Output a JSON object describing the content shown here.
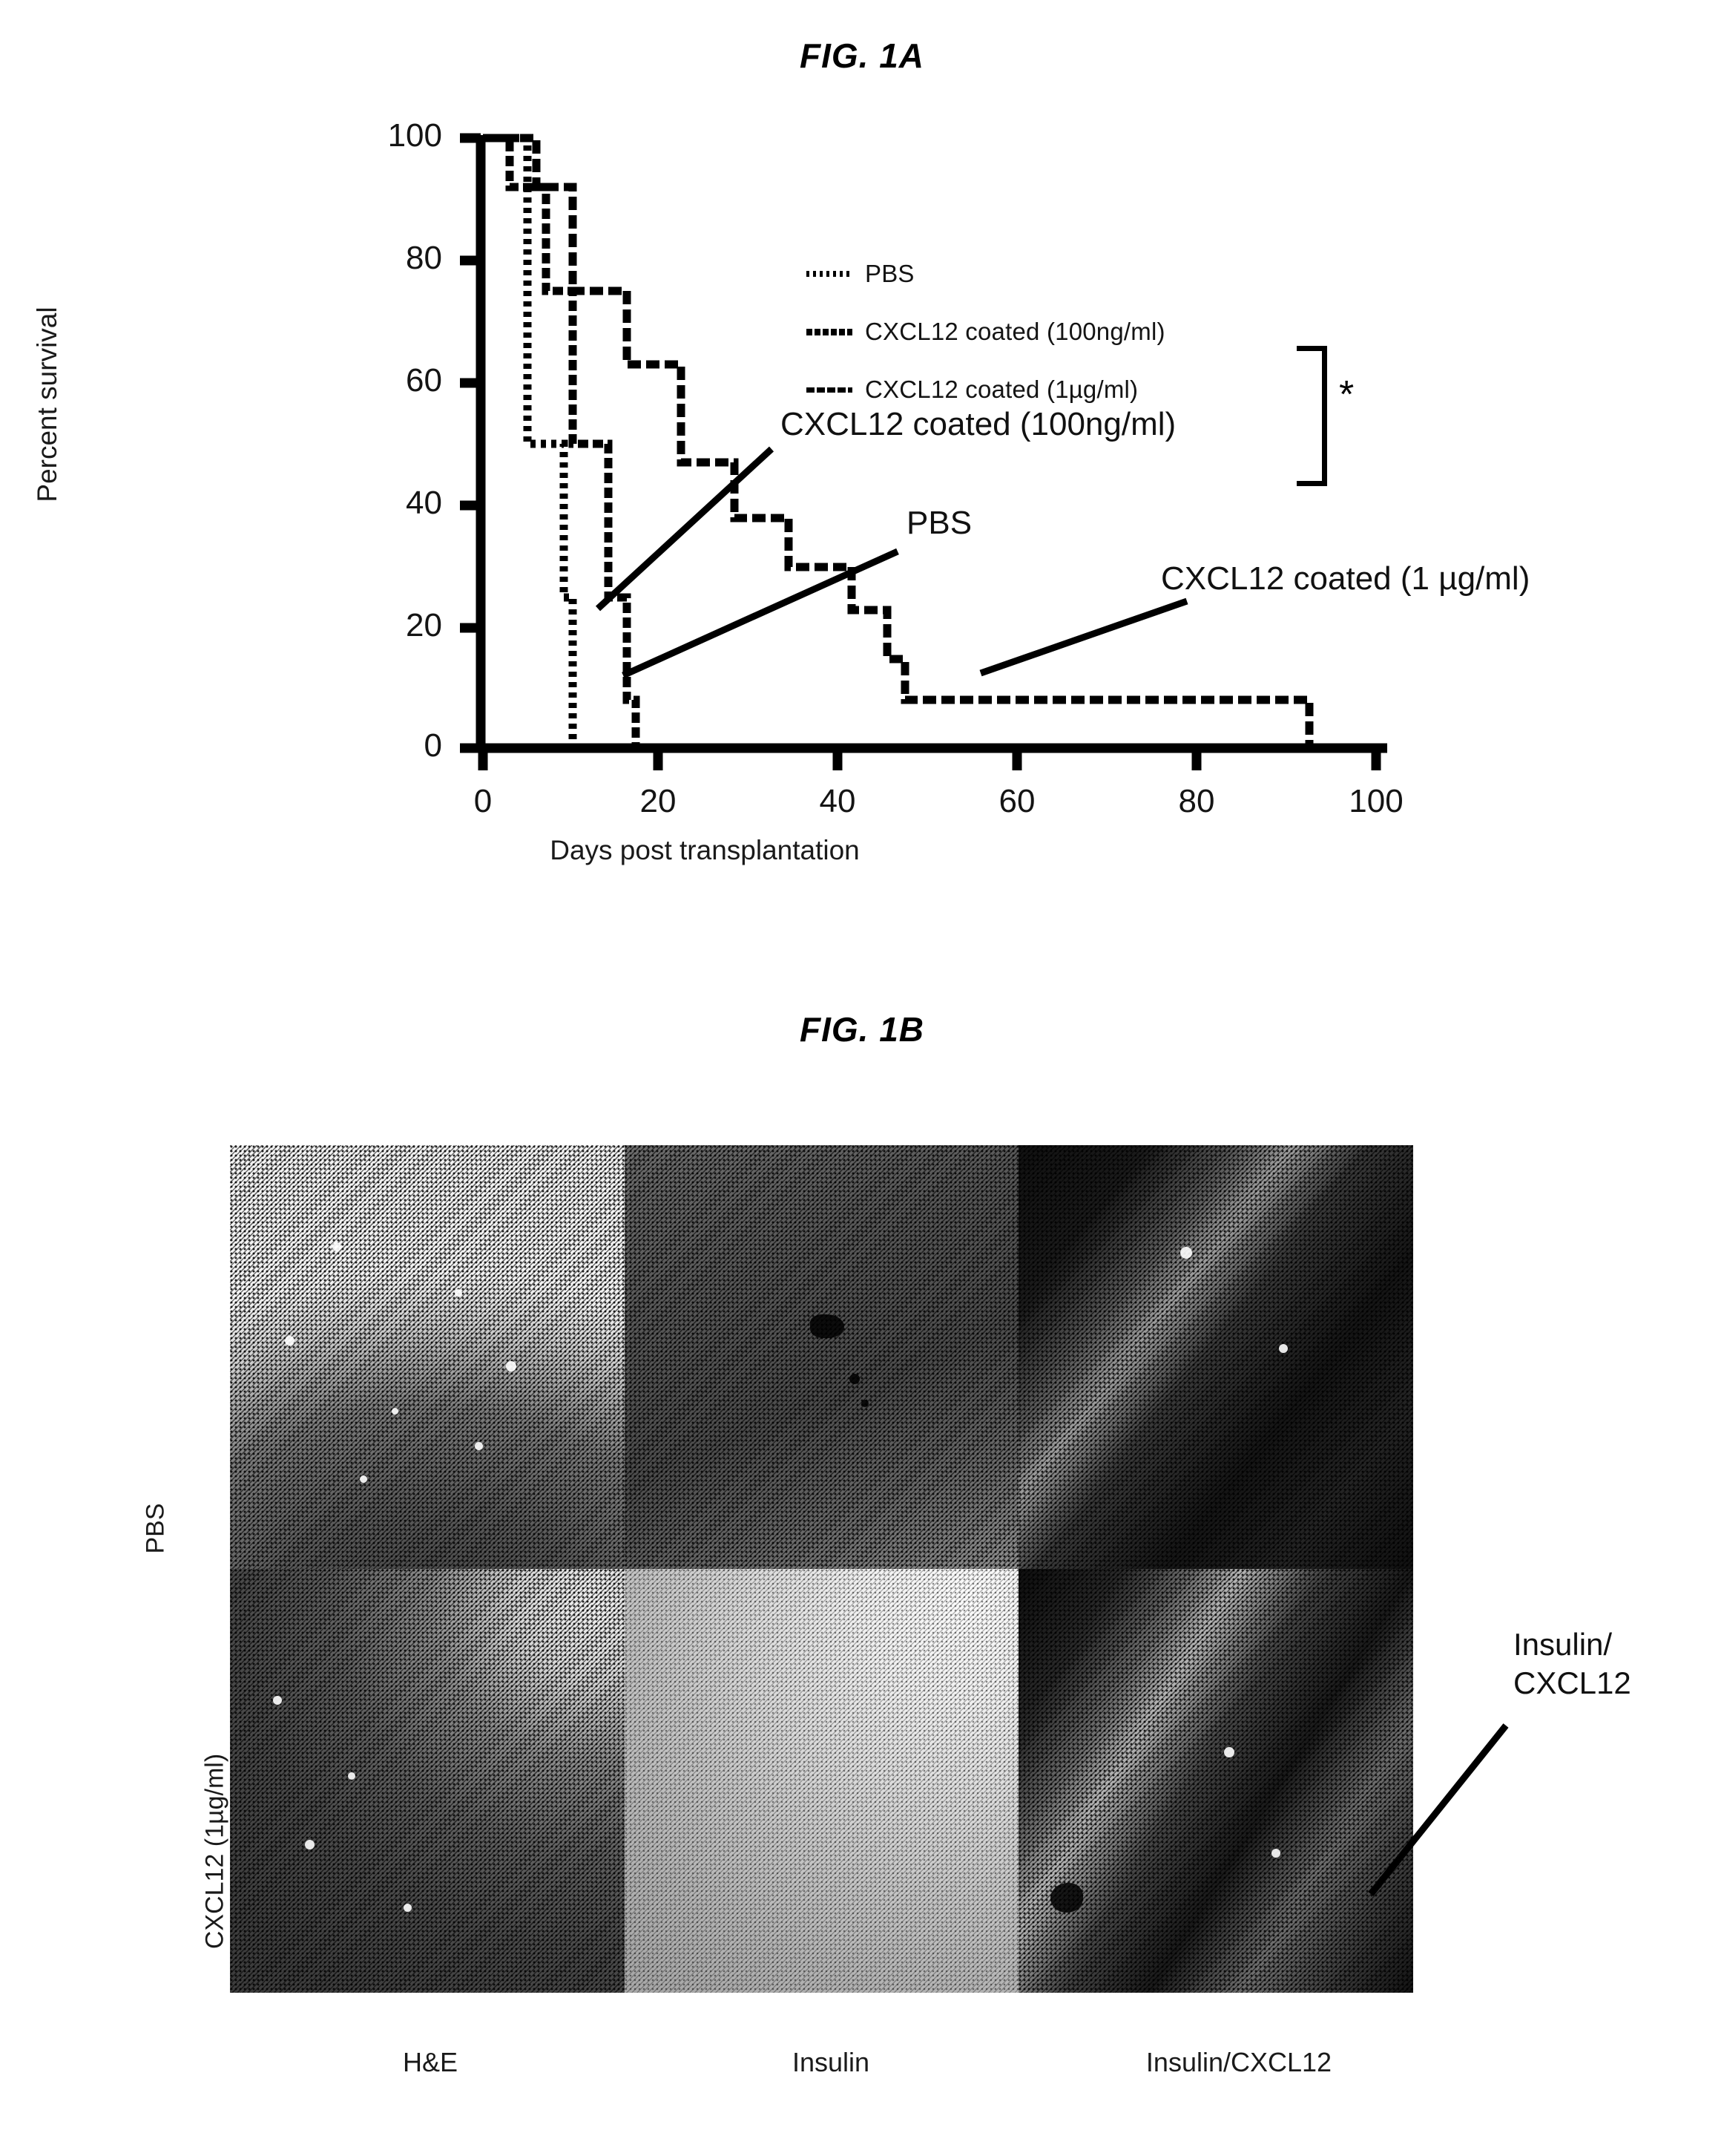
{
  "figures": {
    "fig1a_title": "FIG. 1A",
    "fig1b_title": "FIG. 1B"
  },
  "chart_data": {
    "type": "line",
    "subtype": "kaplan-meier-step",
    "title": "FIG. 1A",
    "xlabel": "Days post transplantation",
    "ylabel": "Percent survival",
    "xlim": [
      0,
      103
    ],
    "ylim": [
      0,
      103
    ],
    "xticks": [
      0,
      20,
      40,
      60,
      80,
      100
    ],
    "yticks": [
      0,
      20,
      40,
      60,
      80,
      100
    ],
    "xtick_labels": [
      "0",
      "20",
      "40",
      "60",
      "80",
      "100"
    ],
    "ytick_labels": [
      "0",
      "20",
      "40",
      "60",
      "80",
      "100"
    ],
    "grid": false,
    "legend_position": "upper-right-inside",
    "significance_marker": "*",
    "significance_compares": [
      "CXCL12 coated (100ng/ml)",
      "CXCL12 coated (1µg/ml)"
    ],
    "series": [
      {
        "name": "PBS",
        "legend_label": "PBS",
        "steps": [
          [
            0,
            100
          ],
          [
            5,
            100
          ],
          [
            5,
            50
          ],
          [
            9,
            50
          ],
          [
            9,
            25
          ],
          [
            10,
            25
          ],
          [
            10,
            0
          ],
          [
            17,
            0
          ]
        ]
      },
      {
        "name": "CXCL12 coated (100ng/ml)",
        "legend_label": "CXCL12 coated (100ng/ml)",
        "steps": [
          [
            0,
            100
          ],
          [
            3,
            100
          ],
          [
            3,
            92
          ],
          [
            7,
            92
          ],
          [
            7,
            75
          ],
          [
            10,
            75
          ],
          [
            10,
            50
          ],
          [
            14,
            50
          ],
          [
            14,
            25
          ],
          [
            16,
            25
          ],
          [
            16,
            8
          ],
          [
            17,
            8
          ],
          [
            17,
            0
          ]
        ]
      },
      {
        "name": "CXCL12 coated (1µg/ml)",
        "legend_label": "CXCL12 coated (1µg/ml)",
        "steps": [
          [
            0,
            100
          ],
          [
            6,
            100
          ],
          [
            6,
            92
          ],
          [
            10,
            92
          ],
          [
            10,
            75
          ],
          [
            16,
            75
          ],
          [
            16,
            63
          ],
          [
            22,
            63
          ],
          [
            22,
            47
          ],
          [
            28,
            47
          ],
          [
            28,
            38
          ],
          [
            34,
            38
          ],
          [
            34,
            30
          ],
          [
            41,
            30
          ],
          [
            41,
            23
          ],
          [
            45,
            23
          ],
          [
            45,
            15
          ],
          [
            47,
            15
          ],
          [
            47,
            8
          ],
          [
            92,
            8
          ],
          [
            92,
            0
          ],
          [
            103,
            0
          ]
        ]
      }
    ],
    "annotations": [
      {
        "text": "CXCL12 coated (100ng/ml)",
        "points_to_series": "CXCL12 coated (100ng/ml)"
      },
      {
        "text": "PBS",
        "points_to_series": "PBS"
      },
      {
        "text": "CXCL12 coated (1 µg/ml)",
        "points_to_series": "CXCL12 coated (1µg/ml)"
      }
    ]
  },
  "fig1b": {
    "column_labels": [
      "H&E",
      "Insulin",
      "Insulin/CXCL12"
    ],
    "row_labels": [
      "PBS",
      "CXCL12 (1µg/ml)"
    ],
    "annotation": {
      "line1": "Insulin/",
      "line2": "CXCL12"
    },
    "panels": [
      {
        "row": "PBS",
        "column": "H&E",
        "name": "panel-he-pbs"
      },
      {
        "row": "PBS",
        "column": "Insulin",
        "name": "panel-insulin-pbs"
      },
      {
        "row": "PBS",
        "column": "Insulin/CXCL12",
        "name": "panel-insulin-cxcl12-pbs"
      },
      {
        "row": "CXCL12 (1µg/ml)",
        "column": "H&E",
        "name": "panel-he-cxcl12"
      },
      {
        "row": "CXCL12 (1µg/ml)",
        "column": "Insulin",
        "name": "panel-insulin-cxcl12"
      },
      {
        "row": "CXCL12 (1µg/ml)",
        "column": "Insulin/CXCL12",
        "name": "panel-insulin-cxcl12-cxcl12"
      }
    ]
  },
  "colors": {
    "ink": "#000000",
    "axis": "#000000",
    "background": "#ffffff"
  }
}
